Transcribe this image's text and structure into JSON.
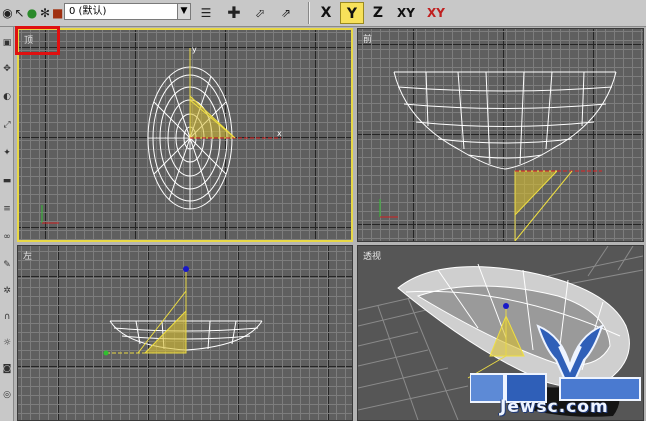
{
  "toolbar": {
    "layer_name": "0 (默认)",
    "axis_buttons": [
      {
        "label": "X",
        "active": false
      },
      {
        "label": "Y",
        "active": true
      },
      {
        "label": "Z",
        "active": false
      },
      {
        "label": "XY",
        "active": false
      },
      {
        "label": "XY",
        "active": false
      }
    ]
  },
  "viewports": {
    "top": {
      "label": "顶",
      "active": true
    },
    "front": {
      "label": "前",
      "active": false
    },
    "left": {
      "label": "左",
      "active": false
    },
    "perspective": {
      "label": "透视",
      "active": false
    }
  },
  "gizmo": {
    "x_label": "x",
    "y_label": "y"
  },
  "watermark": {
    "text": "Jewsc.com"
  },
  "colors": {
    "active_border": "#e8d845",
    "highlight_box": "#e01010",
    "grid_bg": "#5f5f5f",
    "wireframe": "#ffffff",
    "gizmo_plane": "#e8c830",
    "axis_x": "#e02020",
    "axis_y": "#1818c8"
  },
  "icons": {
    "visibility": "eye-icon",
    "select": "cursor-icon",
    "freeze": "snowflake-icon",
    "layer_manager": "layers-icon",
    "add": "plus-icon"
  }
}
